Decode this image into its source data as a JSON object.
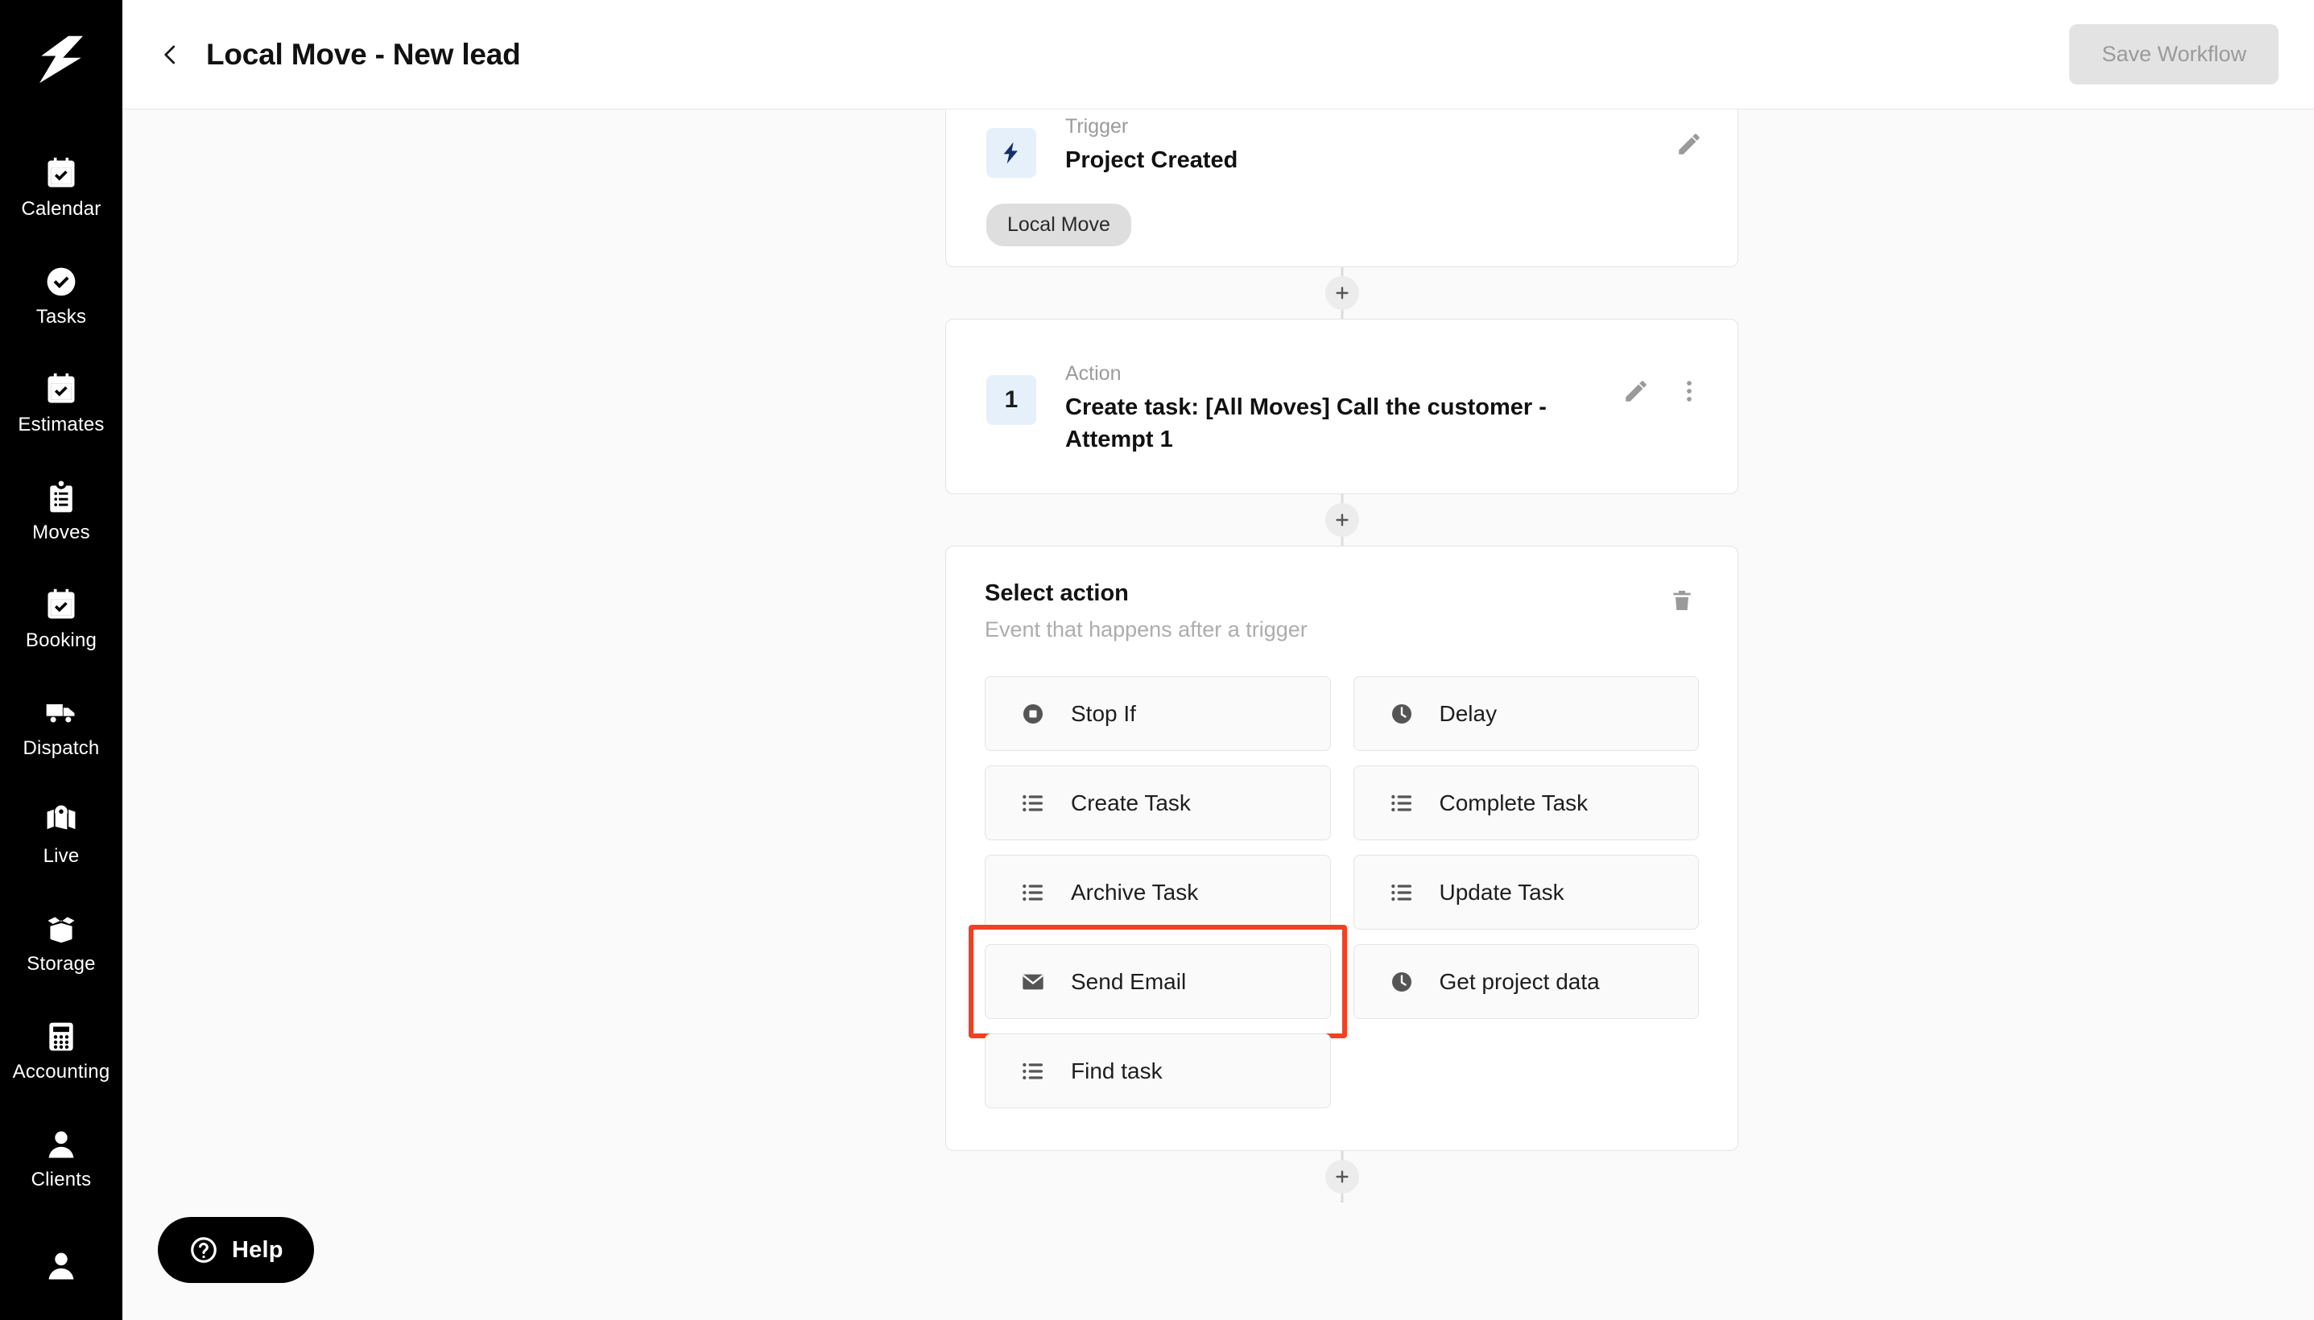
{
  "sidebar": {
    "logo_icon": "bolt-logo",
    "items": [
      {
        "label": "Calendar",
        "icon": "calendar-check-icon"
      },
      {
        "label": "Tasks",
        "icon": "check-circle-icon"
      },
      {
        "label": "Estimates",
        "icon": "calendar-check-icon"
      },
      {
        "label": "Moves",
        "icon": "clipboard-list-icon"
      },
      {
        "label": "Booking",
        "icon": "calendar-check-icon"
      },
      {
        "label": "Dispatch",
        "icon": "truck-icon"
      },
      {
        "label": "Live",
        "icon": "map-pin-icon"
      },
      {
        "label": "Storage",
        "icon": "open-box-icon"
      },
      {
        "label": "Accounting",
        "icon": "calculator-icon"
      },
      {
        "label": "Clients",
        "icon": "person-icon"
      },
      {
        "label": "",
        "icon": "person-icon"
      }
    ]
  },
  "topbar": {
    "back_icon": "chevron-left-icon",
    "title": "Local Move - New lead",
    "save_label": "Save Workflow"
  },
  "flow": {
    "trigger": {
      "badge_icon": "bolt-icon",
      "kicker": "Trigger",
      "title": "Project Created",
      "chip": "Local Move",
      "edit_icon": "pencil-icon"
    },
    "action": {
      "badge_number": "1",
      "kicker": "Action",
      "title": "Create task: [All Moves] Call the customer - Attempt 1",
      "edit_icon": "pencil-icon",
      "more_icon": "more-vertical-icon"
    },
    "select_panel": {
      "title": "Select action",
      "subtitle": "Event that happens after a trigger",
      "delete_icon": "trash-icon",
      "options": [
        {
          "label": "Stop If",
          "icon": "stop-circle-icon"
        },
        {
          "label": "Delay",
          "icon": "clock-icon"
        },
        {
          "label": "Create Task",
          "icon": "list-icon"
        },
        {
          "label": "Complete Task",
          "icon": "list-icon"
        },
        {
          "label": "Archive Task",
          "icon": "list-icon"
        },
        {
          "label": "Update Task",
          "icon": "list-icon"
        },
        {
          "label": "Send Email",
          "icon": "envelope-icon",
          "highlighted": true
        },
        {
          "label": "Get project data",
          "icon": "clock-icon"
        },
        {
          "label": "Find task",
          "icon": "list-icon"
        }
      ]
    },
    "add_step_icon": "plus-icon"
  },
  "help": {
    "label": "Help",
    "icon": "question-circle-icon"
  },
  "colors": {
    "sidebar_bg": "#000000",
    "page_bg": "#fafafa",
    "accent_highlight": "#ef4123",
    "trigger_badge_bg": "#e6f0fb",
    "trigger_badge_fg": "#14306b",
    "save_btn_bg": "#e3e3e3",
    "save_btn_fg": "#9a9a9a"
  }
}
